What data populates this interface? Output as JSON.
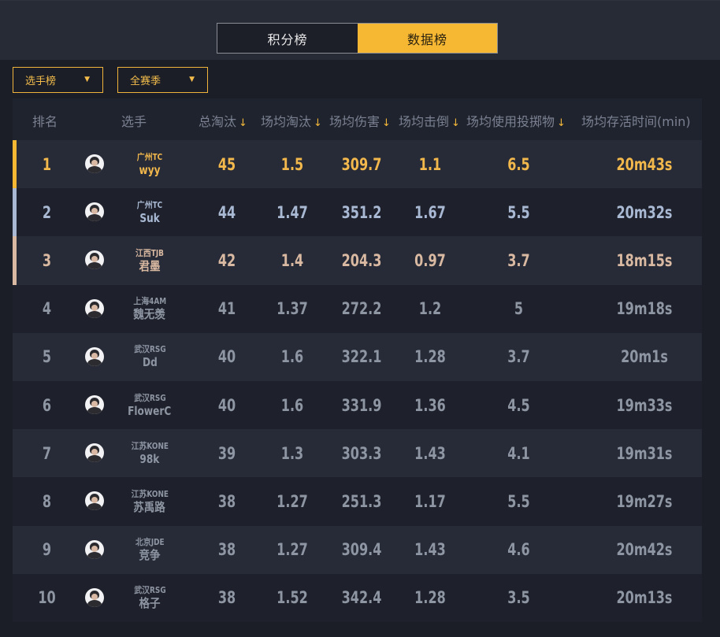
{
  "tabs": {
    "left": "积分榜",
    "right": "数据榜"
  },
  "filters": {
    "board": "选手榜",
    "season": "全赛季"
  },
  "columns": {
    "rank": "排名",
    "player": "选手",
    "kills": "总淘汰",
    "avg_kills": "场均淘汰",
    "avg_damage": "场均伤害",
    "avg_knocks": "场均击倒",
    "avg_throwables": "场均使用投掷物",
    "avg_survival": "场均存活时间(min)"
  },
  "colors": {
    "accent": "#f6b732",
    "gold": "#f2b84c",
    "silver": "#a9b9d4",
    "bronze": "#d9b9a1",
    "gray": "#8e95a3"
  },
  "rows": [
    {
      "rank": "1",
      "team": "广州TC",
      "name": "wyy",
      "kills": "45",
      "avg_kills": "1.5",
      "avg_damage": "309.7",
      "avg_knocks": "1.1",
      "avg_throwables": "6.5",
      "avg_survival": "20m43s"
    },
    {
      "rank": "2",
      "team": "广州TC",
      "name": "Suk",
      "kills": "44",
      "avg_kills": "1.47",
      "avg_damage": "351.2",
      "avg_knocks": "1.67",
      "avg_throwables": "5.5",
      "avg_survival": "20m32s"
    },
    {
      "rank": "3",
      "team": "江西TJB",
      "name": "君墨",
      "kills": "42",
      "avg_kills": "1.4",
      "avg_damage": "204.3",
      "avg_knocks": "0.97",
      "avg_throwables": "3.7",
      "avg_survival": "18m15s"
    },
    {
      "rank": "4",
      "team": "上海4AM",
      "name": "魏无羡",
      "kills": "41",
      "avg_kills": "1.37",
      "avg_damage": "272.2",
      "avg_knocks": "1.2",
      "avg_throwables": "5",
      "avg_survival": "19m18s"
    },
    {
      "rank": "5",
      "team": "武汉RSG",
      "name": "Dd",
      "kills": "40",
      "avg_kills": "1.6",
      "avg_damage": "322.1",
      "avg_knocks": "1.28",
      "avg_throwables": "3.7",
      "avg_survival": "20m1s"
    },
    {
      "rank": "6",
      "team": "武汉RSG",
      "name": "FlowerC",
      "kills": "40",
      "avg_kills": "1.6",
      "avg_damage": "331.9",
      "avg_knocks": "1.36",
      "avg_throwables": "4.5",
      "avg_survival": "19m33s"
    },
    {
      "rank": "7",
      "team": "江苏KONE",
      "name": "98k",
      "kills": "39",
      "avg_kills": "1.3",
      "avg_damage": "303.3",
      "avg_knocks": "1.43",
      "avg_throwables": "4.1",
      "avg_survival": "19m31s"
    },
    {
      "rank": "8",
      "team": "江苏KONE",
      "name": "苏禹路",
      "kills": "38",
      "avg_kills": "1.27",
      "avg_damage": "251.3",
      "avg_knocks": "1.17",
      "avg_throwables": "5.5",
      "avg_survival": "19m27s"
    },
    {
      "rank": "9",
      "team": "北京JDE",
      "name": "竞争",
      "kills": "38",
      "avg_kills": "1.27",
      "avg_damage": "309.4",
      "avg_knocks": "1.43",
      "avg_throwables": "4.6",
      "avg_survival": "20m42s"
    },
    {
      "rank": "10",
      "team": "武汉RSG",
      "name": "格子",
      "kills": "38",
      "avg_kills": "1.52",
      "avg_damage": "342.4",
      "avg_knocks": "1.28",
      "avg_throwables": "3.5",
      "avg_survival": "20m13s"
    }
  ]
}
